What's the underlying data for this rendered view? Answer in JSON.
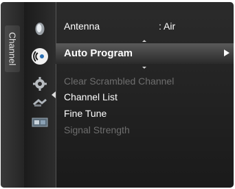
{
  "tab": {
    "label": "Channel"
  },
  "icons": [
    "picture-icon",
    "channel-icon",
    "setup-icon",
    "input-icon",
    "application-icon"
  ],
  "menu": {
    "antenna_label": "Antenna",
    "antenna_value": ": Air",
    "selected_label": "Auto Program",
    "items": [
      {
        "label": "Clear Scrambled Channel",
        "enabled": false
      },
      {
        "label": "Channel List",
        "enabled": true
      },
      {
        "label": "Fine Tune",
        "enabled": true
      },
      {
        "label": "Signal Strength",
        "enabled": false
      }
    ]
  }
}
